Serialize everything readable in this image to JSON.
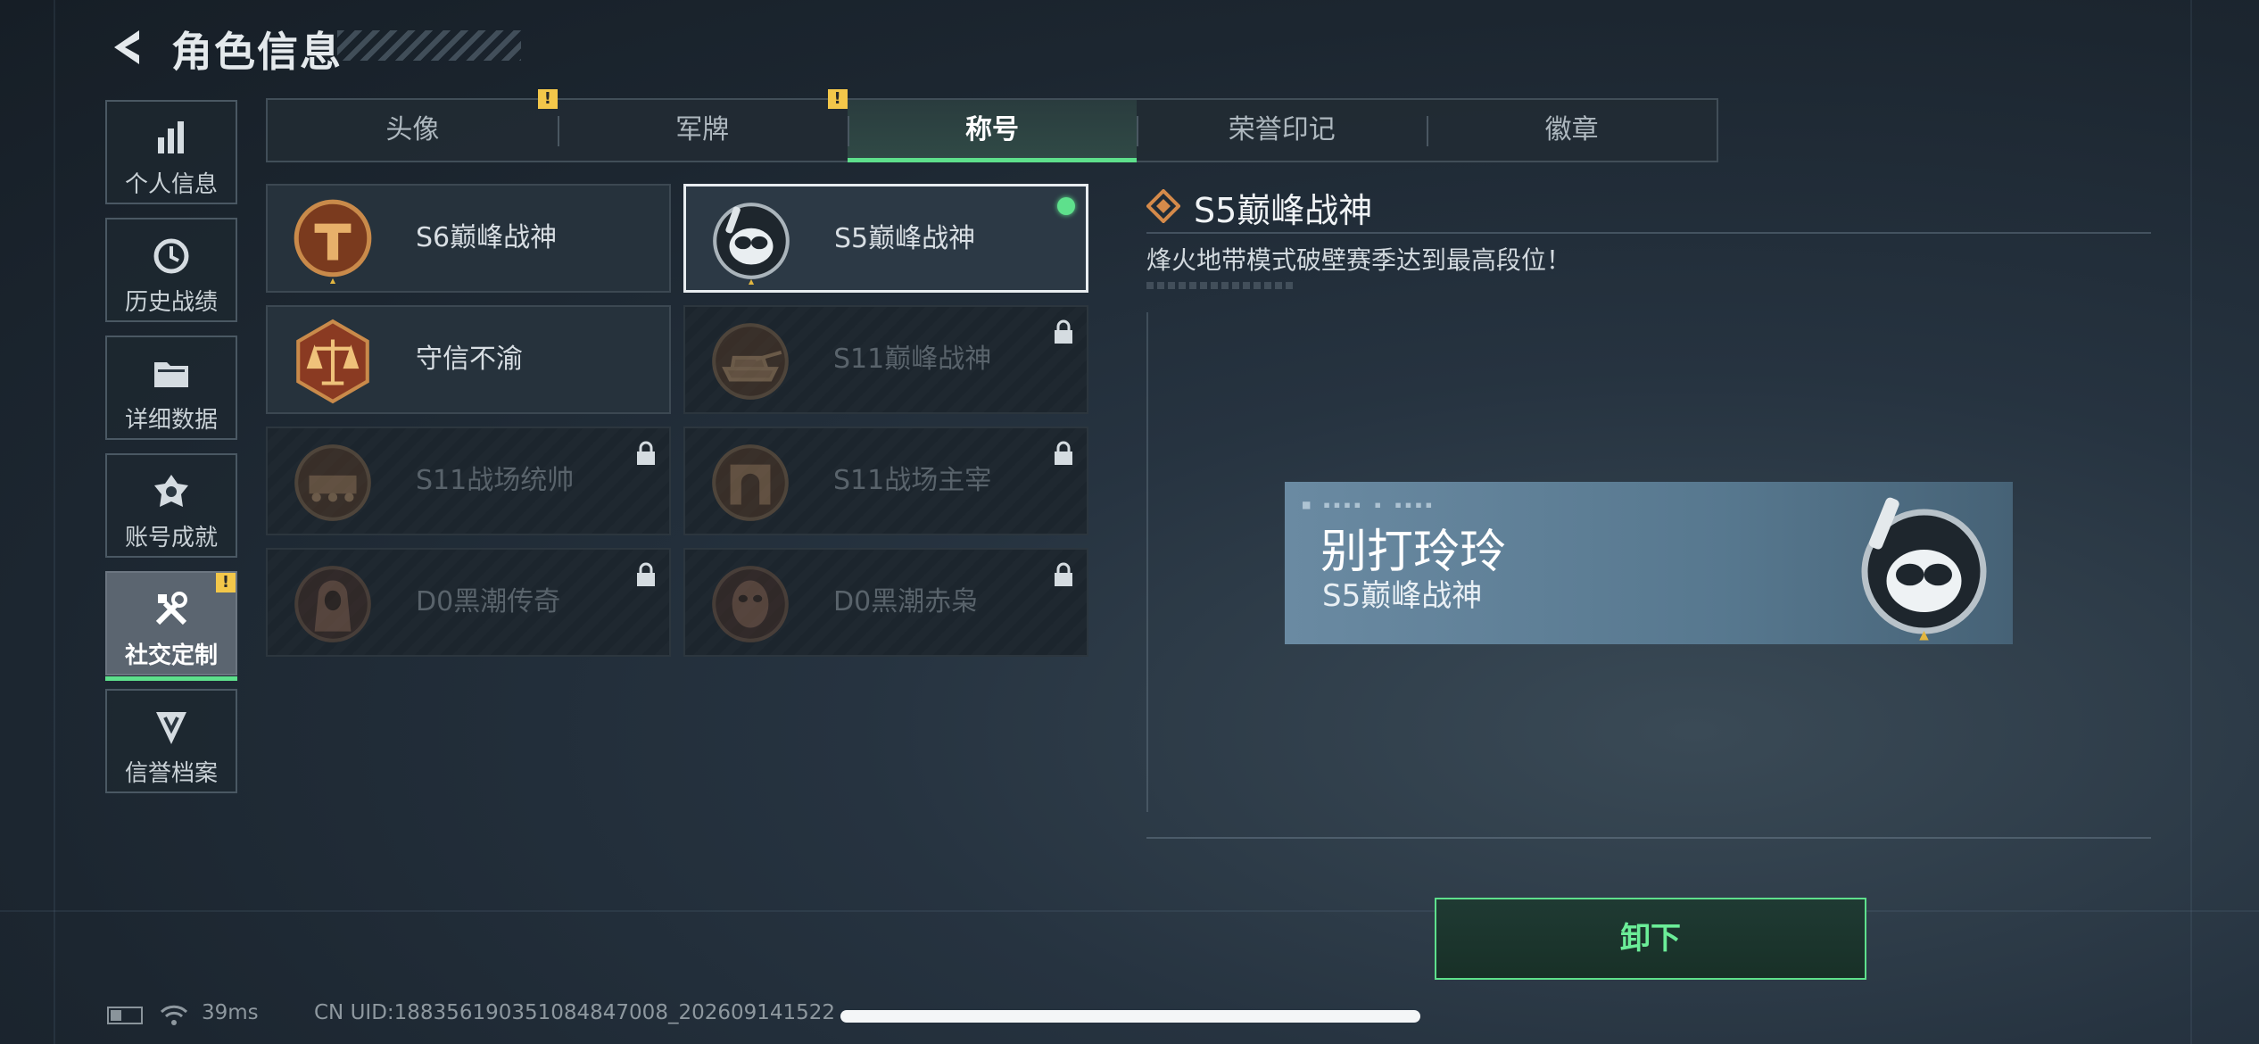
{
  "header": {
    "title": "角色信息"
  },
  "sidebar": {
    "items": [
      {
        "label": "个人信息",
        "icon": "bar-chart-icon"
      },
      {
        "label": "历史战绩",
        "icon": "clock-icon"
      },
      {
        "label": "详细数据",
        "icon": "folder-icon"
      },
      {
        "label": "账号成就",
        "icon": "achievement-icon"
      },
      {
        "label": "社交定制",
        "icon": "tools-icon",
        "active": true,
        "alert": "!"
      },
      {
        "label": "信誉档案",
        "icon": "shield-icon"
      }
    ]
  },
  "tabs": [
    {
      "label": "头像",
      "alert": "!"
    },
    {
      "label": "军牌",
      "alert": "!"
    },
    {
      "label": "称号",
      "active": true
    },
    {
      "label": "荣誉印记"
    },
    {
      "label": "徽章"
    }
  ],
  "titles": [
    {
      "name": "S6巅峰战神",
      "locked": false,
      "emblem": "bronze-t-emblem-icon"
    },
    {
      "name": "S5巅峰战神",
      "locked": false,
      "selected": true,
      "equipped": true,
      "emblem": "skull-diver-emblem-icon"
    },
    {
      "name": "守信不渝",
      "locked": false,
      "emblem": "scales-emblem-icon"
    },
    {
      "name": "S11巅峰战神",
      "locked": true,
      "emblem": "tank-emblem-icon"
    },
    {
      "name": "S11战场统帅",
      "locked": true,
      "emblem": "armored-vehicle-emblem-icon"
    },
    {
      "name": "S11战场主宰",
      "locked": true,
      "emblem": "arch-emblem-icon"
    },
    {
      "name": "D0黑潮传奇",
      "locked": true,
      "emblem": "hooded-figure-emblem-icon"
    },
    {
      "name": "D0黑潮赤枭",
      "locked": true,
      "emblem": "masked-face-emblem-icon"
    }
  ],
  "detail": {
    "title": "S5巅峰战神",
    "description": "烽火地带模式破壁赛季达到最高段位！",
    "nameplate": {
      "player_name": "别打玲玲",
      "title": "S5巅峰战神"
    },
    "action_label": "卸下"
  },
  "status_bar": {
    "ping": "39ms",
    "uid": "CN UID:1883561903510848470​08_202609141522"
  },
  "colors": {
    "accent": "#5ee08c",
    "alert": "#f3c74a"
  }
}
